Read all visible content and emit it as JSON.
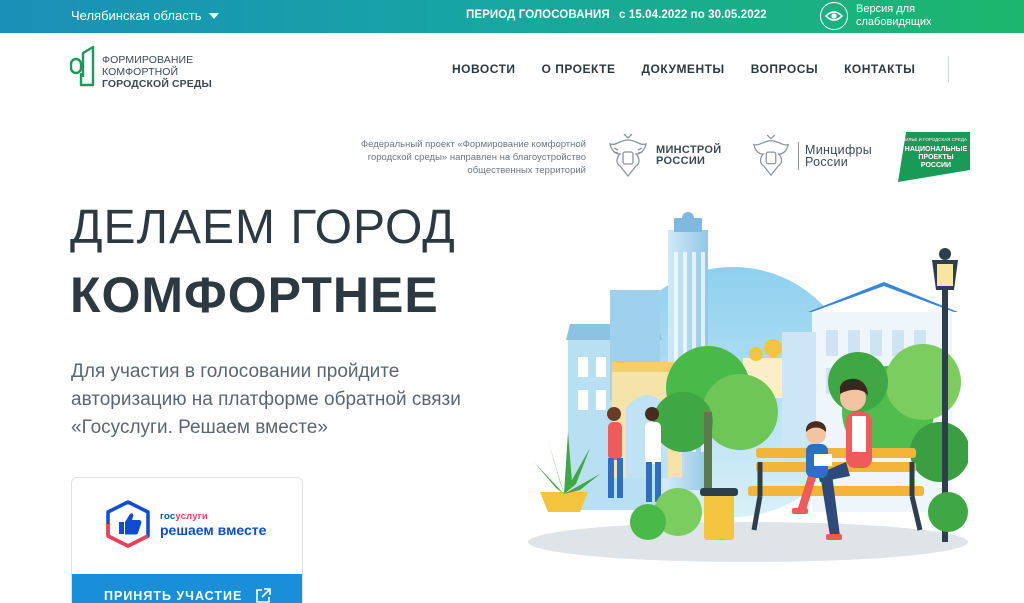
{
  "topbar": {
    "region": "Челябинская область",
    "period_label": "ПЕРИОД ГОЛОСОВАНИЯ",
    "period_dates": "с 15.04.2022 по 30.05.2022",
    "vision_label": "Версия для слабовидящих"
  },
  "logo": {
    "line1": "Формирование",
    "line2": "комфортной",
    "line3": "городской среды"
  },
  "nav": {
    "items": [
      "НОВОСТИ",
      "О ПРОЕКТЕ",
      "ДОКУМЕНТЫ",
      "ВОПРОСЫ",
      "КОНТАКТЫ"
    ]
  },
  "partners": {
    "description": "Федеральный проект «Формирование комфортной городской среды» направлен на благоустройство общественных территорий",
    "minstroy_line1": "МИНСТРОЙ",
    "minstroy_line2": "РОССИИ",
    "mincifry_line1": "Минцифры",
    "mincifry_line2": "России",
    "natproj_small": "ЖИЛЬЕ И ГОРОДСКАЯ СРЕДА",
    "natproj_line1": "НАЦИОНАЛЬНЫЕ",
    "natproj_line2": "ПРОЕКТЫ",
    "natproj_line3": "РОССИИ"
  },
  "hero": {
    "title_line1": "ДЕЛАЕМ ГОРОД",
    "title_line2": "КОМФОРТНЕЕ",
    "description": "Для участия в голосовании пройдите авторизацию на платформе обратной связи «Госуслуги. Решаем вместе»"
  },
  "card": {
    "gos_prefix": "гос",
    "gos_suffix": "услуги",
    "brand": "решаем вместе",
    "cta_label": "ПРИНЯТЬ УЧАСТИЕ"
  },
  "icons": {
    "caret": "chevron-down-icon",
    "vision": "eye-icon",
    "cta": "external-link-icon"
  },
  "colors": {
    "topbar_start": "#1a8fb8",
    "topbar_end": "#1cb76c",
    "brand_green": "#1a9a59",
    "cta_blue": "#1a8fd9",
    "text_dark": "#2d3940"
  }
}
